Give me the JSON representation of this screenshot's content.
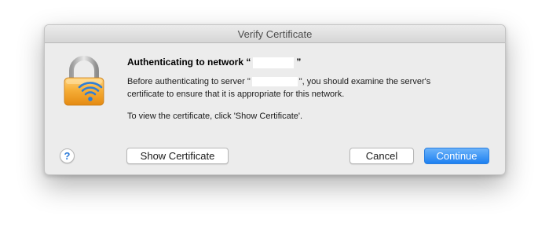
{
  "window": {
    "title": "Verify Certificate"
  },
  "dialog": {
    "heading_prefix": "Authenticating to network “",
    "heading_suffix": "”",
    "body_line1_prefix": "Before authenticating to server \"",
    "body_line1_suffix": "\", you should examine the server's",
    "body_line2": "certificate to ensure that it is appropriate for this network.",
    "instruction": "To view the certificate, click 'Show Certificate'."
  },
  "buttons": {
    "help": "?",
    "show_certificate": "Show Certificate",
    "cancel": "Cancel",
    "continue": "Continue"
  },
  "icons": {
    "main": "lock-wifi-icon"
  },
  "colors": {
    "accent": "#1d80f1",
    "lock_body": "#f4a731",
    "wifi": "#2f7ed6"
  }
}
